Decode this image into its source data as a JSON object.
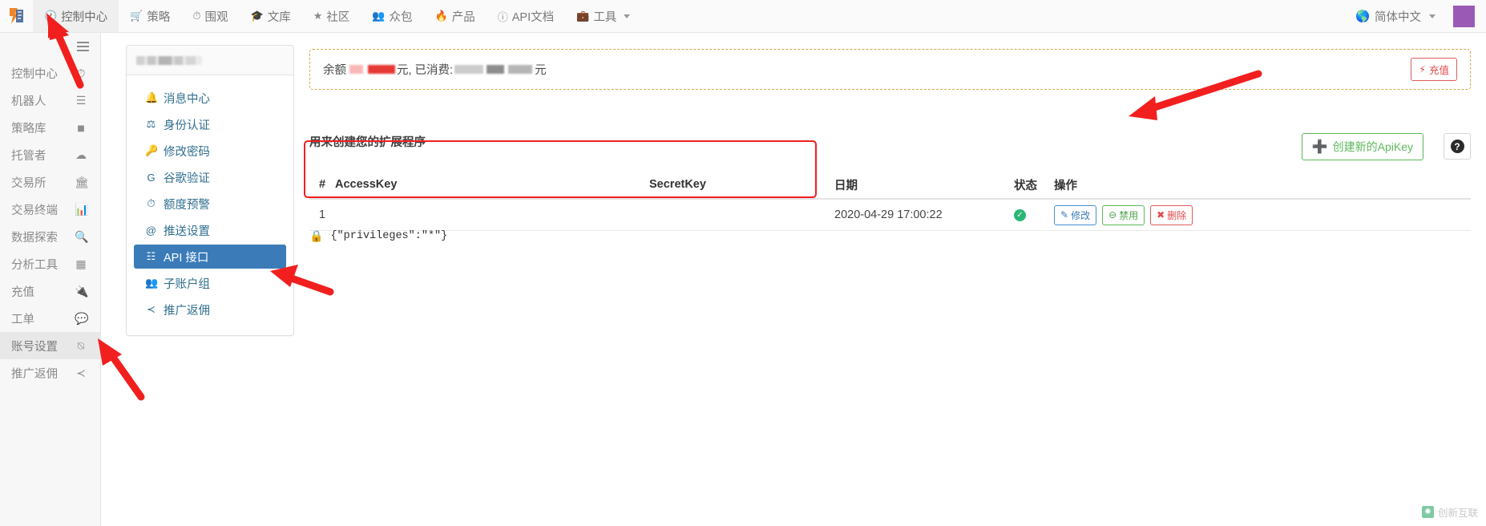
{
  "topnav": {
    "brand_icon": "fmz-logo-icon",
    "items": [
      {
        "label": "控制中心",
        "icon": "dashboard-icon",
        "active": true
      },
      {
        "label": "策略",
        "icon": "cart-icon",
        "active": false
      },
      {
        "label": "围观",
        "icon": "clock-icon",
        "active": false
      },
      {
        "label": "文库",
        "icon": "book-icon",
        "active": false
      },
      {
        "label": "社区",
        "icon": "star-icon",
        "active": false
      },
      {
        "label": "众包",
        "icon": "users-icon",
        "active": false
      },
      {
        "label": "产品",
        "icon": "fire-icon",
        "active": false
      },
      {
        "label": "API文档",
        "icon": "info-icon",
        "active": false
      },
      {
        "label": "工具",
        "icon": "briefcase-icon",
        "active": false,
        "has_caret": true
      }
    ],
    "language": {
      "label": "简体中文",
      "icon": "globe-icon"
    },
    "avatar_color": "#9b59b6"
  },
  "sidebar": {
    "menu_icon": "hamburger-icon",
    "items": [
      {
        "label": "控制中心",
        "icon": "gauge-icon",
        "active": false
      },
      {
        "label": "机器人",
        "icon": "server-icon",
        "active": false
      },
      {
        "label": "策略库",
        "icon": "cube-icon",
        "active": false
      },
      {
        "label": "托管者",
        "icon": "cloud-icon",
        "active": false
      },
      {
        "label": "交易所",
        "icon": "bank-icon",
        "active": false
      },
      {
        "label": "交易终端",
        "icon": "chart-bar-icon",
        "active": false
      },
      {
        "label": "数据探索",
        "icon": "search-plus-icon",
        "active": false
      },
      {
        "label": "分析工具",
        "icon": "grid-icon",
        "active": false
      },
      {
        "label": "充值",
        "icon": "plug-icon",
        "active": false
      },
      {
        "label": "工单",
        "icon": "comment-icon",
        "active": false
      },
      {
        "label": "账号设置",
        "icon": "user-circle-icon",
        "active": true
      },
      {
        "label": "推广返佣",
        "icon": "share-icon",
        "active": false
      }
    ]
  },
  "menupanel": {
    "header_redacted": true,
    "items": [
      {
        "label": "消息中心",
        "icon": "bell-icon",
        "active": false
      },
      {
        "label": "身份认证",
        "icon": "id-card-icon",
        "active": false
      },
      {
        "label": "修改密码",
        "icon": "key-icon",
        "active": false
      },
      {
        "label": "谷歌验证",
        "icon": "google-g-icon",
        "active": false
      },
      {
        "label": "额度预警",
        "icon": "clock-icon",
        "active": false
      },
      {
        "label": "推送设置",
        "icon": "at-icon",
        "active": false
      },
      {
        "label": "API 接口",
        "icon": "sitemap-icon",
        "active": true
      },
      {
        "label": "子账户组",
        "icon": "users-group-icon",
        "active": false
      },
      {
        "label": "推广返佣",
        "icon": "share-alt-icon",
        "active": false
      }
    ],
    "active_bg": "#3a7bb8"
  },
  "balance": {
    "prefix": "余额",
    "unit1": "元, 已消费:",
    "unit2": "元",
    "recharge_label": "充值",
    "recharge_icon": "bolt-icon",
    "border_color": "#d8a64a",
    "recharge_color": "#e04b4b"
  },
  "content": {
    "section_title": "用来创建您的扩展程序",
    "create_button": {
      "label": "创建新的ApiKey",
      "icon": "plus-icon",
      "color": "#5cb85c"
    },
    "help_button": {
      "icon": "question-circle-icon"
    }
  },
  "table": {
    "columns": [
      "#",
      "AccessKey",
      "SecretKey",
      "日期",
      "状态",
      "操作"
    ],
    "rows": [
      {
        "num": "1",
        "accesskey": "",
        "secretkey": "",
        "date": "2020-04-29 17:00:22",
        "status_icon": "check-circle-icon",
        "status_color": "#2bb673",
        "ops": [
          {
            "label": "修改",
            "icon": "edit-icon",
            "color": "#3a7bb8"
          },
          {
            "label": "禁用",
            "icon": "ban-icon",
            "color": "#4fa14f"
          },
          {
            "label": "删除",
            "icon": "delete-icon",
            "color": "#e04b4b"
          }
        ]
      }
    ],
    "privileges": {
      "icon": "lock-icon",
      "text": "{\"privileges\":\"*\"}"
    }
  },
  "annotations": {
    "highlight_color": "#f21f1f",
    "arrows": [
      {
        "name": "arrow-to-control-center"
      },
      {
        "name": "arrow-to-create-apikey"
      },
      {
        "name": "arrow-to-api-menu"
      },
      {
        "name": "arrow-to-account-settings"
      }
    ]
  },
  "watermark": {
    "text": "创新互联",
    "icon": "leaf-icon"
  }
}
